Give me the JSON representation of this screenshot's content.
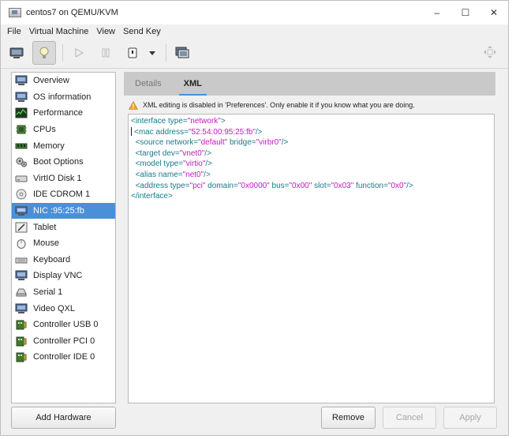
{
  "window": {
    "title": "centos7 on QEMU/KVM",
    "controls": [
      "–",
      "☐",
      "✕"
    ]
  },
  "menubar": [
    "File",
    "Virtual Machine",
    "View",
    "Send Key"
  ],
  "toolbar": {
    "buttons": [
      "monitor-icon",
      "lightbulb-icon",
      "play-icon",
      "pause-icon",
      "power-icon",
      "dropdown-arrow-icon",
      "screenshot-icon",
      "fullscreen-icon"
    ],
    "active": "lightbulb-icon"
  },
  "sidebar": {
    "items": [
      {
        "label": "Overview",
        "icon": "monitor-icon"
      },
      {
        "label": "OS information",
        "icon": "monitor-icon"
      },
      {
        "label": "Performance",
        "icon": "performance-icon"
      },
      {
        "label": "CPUs",
        "icon": "cpu-icon"
      },
      {
        "label": "Memory",
        "icon": "memory-icon"
      },
      {
        "label": "Boot Options",
        "icon": "gears-icon"
      },
      {
        "label": "VirtIO Disk 1",
        "icon": "disk-icon"
      },
      {
        "label": "IDE CDROM 1",
        "icon": "cdrom-icon"
      },
      {
        "label": "NIC :95:25:fb",
        "icon": "nic-icon"
      },
      {
        "label": "Tablet",
        "icon": "tablet-icon"
      },
      {
        "label": "Mouse",
        "icon": "mouse-icon"
      },
      {
        "label": "Keyboard",
        "icon": "keyboard-icon"
      },
      {
        "label": "Display VNC",
        "icon": "monitor-icon"
      },
      {
        "label": "Serial 1",
        "icon": "serial-icon"
      },
      {
        "label": "Video QXL",
        "icon": "monitor-icon"
      },
      {
        "label": "Controller USB 0",
        "icon": "controller-icon"
      },
      {
        "label": "Controller PCI 0",
        "icon": "controller-icon"
      },
      {
        "label": "Controller IDE 0",
        "icon": "controller-icon"
      }
    ],
    "selected_index": 8
  },
  "buttons": {
    "add_hardware": "Add Hardware",
    "remove": "Remove",
    "cancel": "Cancel",
    "apply": "Apply"
  },
  "tabs": {
    "details": "Details",
    "xml": "XML",
    "active": "XML"
  },
  "warning": "XML editing is disabled in 'Preferences'. Only enable it if you know what you are doing.",
  "xml": {
    "line1": {
      "open": "<interface ",
      "attr1": "type=",
      "val1": "\"network\"",
      "close": ">"
    },
    "line2": {
      "open": "<mac ",
      "attr1": "address=",
      "val1": "\"52:54:00:95:25:fb\"",
      "close": "/>"
    },
    "line3": {
      "open": "<source ",
      "attr1": "network=",
      "val1": "\"default\"",
      "attr2": " bridge=",
      "val2": "\"virbr0\"",
      "close": "/>"
    },
    "line4": {
      "open": "<target ",
      "attr1": "dev=",
      "val1": "\"vnet0\"",
      "close": "/>"
    },
    "line5": {
      "open": "<model ",
      "attr1": "type=",
      "val1": "\"virtio\"",
      "close": "/>"
    },
    "line6": {
      "open": "<alias ",
      "attr1": "name=",
      "val1": "\"net0\"",
      "close": "/>"
    },
    "line7": {
      "open": "<address ",
      "attr1": "type=",
      "val1": "\"pci\"",
      "attr2": " domain=",
      "val2": "\"0x0000\"",
      "attr3": " bus=",
      "val3": "\"0x00\"",
      "attr4": " slot=",
      "val4": "\"0x03\"",
      "attr5": " function=",
      "val5": "\"0x0\"",
      "close": "/>"
    },
    "line8": {
      "open": "</interface>"
    }
  },
  "colors": {
    "selection": "#4a90d9",
    "xml_tag": "#1a7a8a",
    "xml_value": "#c218c2",
    "tab_bar": "#c9c9c9"
  }
}
